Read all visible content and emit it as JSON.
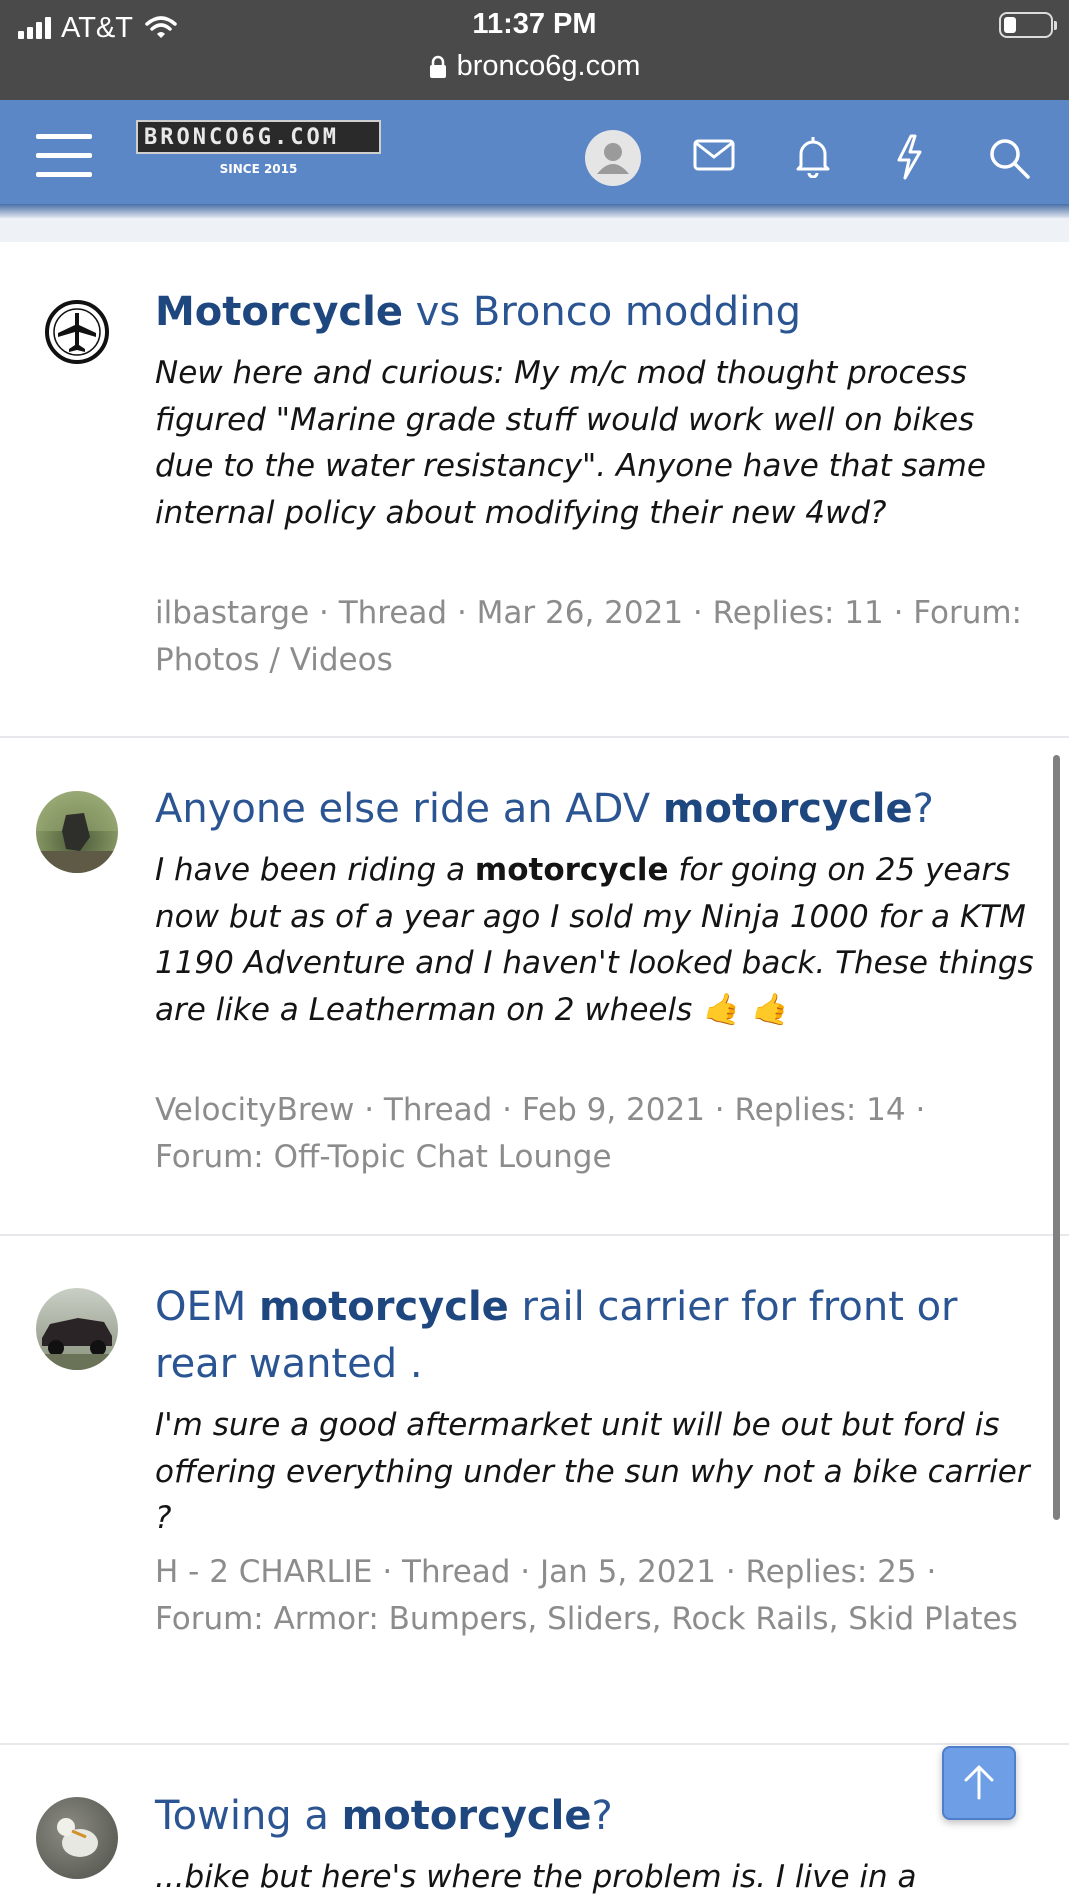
{
  "status_bar": {
    "carrier": "AT&T",
    "time": "11:37 PM",
    "url": "bronco6g.com"
  },
  "header": {
    "logo_text": "BRONCO6G.COM",
    "logo_sub": "SINCE 2015",
    "icons": [
      "menu-icon",
      "user-icon",
      "envelope-icon",
      "bell-icon",
      "lightning-icon",
      "search-icon"
    ],
    "accent": "#5b87c7"
  },
  "threads": [
    {
      "title_pre": "",
      "title_bold": "Motorcycle",
      "title_post": " vs Bronco modding",
      "snippet_pre": "New here and curious: My m/c mod thought process figured \"Marine grade stuff would work well on bikes due to the water resistancy\". Anyone have that same internal policy about modifying their new 4wd?",
      "snippet_bold": "",
      "snippet_post": "",
      "meta": "ilbastarge · Thread · Mar 26, 2021 · Replies: 11 · Forum: Photos / Videos"
    },
    {
      "title_pre": "Anyone else ride an ADV ",
      "title_bold": "motorcycle",
      "title_post": "?",
      "snippet_pre": "I have been riding a ",
      "snippet_bold": "motorcycle",
      "snippet_post": " for going on 25 years now but as of a year ago I sold my Ninja 1000 for a KTM 1190 Adventure and I haven't looked back. These things are like a Leatherman on 2 wheels 🤙 🤙",
      "meta": "VelocityBrew · Thread · Feb 9, 2021 · Replies: 14 · Forum: Off-Topic Chat Lounge"
    },
    {
      "title_pre": "OEM ",
      "title_bold": "motorcycle",
      "title_post": " rail carrier for front or rear wanted .",
      "snippet_pre": "I'm sure a good aftermarket unit will be out but ford is offering everything under the sun why not a bike carrier ?",
      "snippet_bold": "",
      "snippet_post": "",
      "meta": "H - 2 CHARLIE · Thread · Jan 5, 2021 · Replies: 25 · Forum: Armor: Bumpers, Sliders, Rock Rails, Skid Plates"
    },
    {
      "title_pre": "Towing a ",
      "title_bold": "motorcycle",
      "title_post": "?",
      "snippet_pre": "...bike but here's where the problem is. I live in a",
      "snippet_bold": "",
      "snippet_post": "",
      "meta": ""
    }
  ]
}
